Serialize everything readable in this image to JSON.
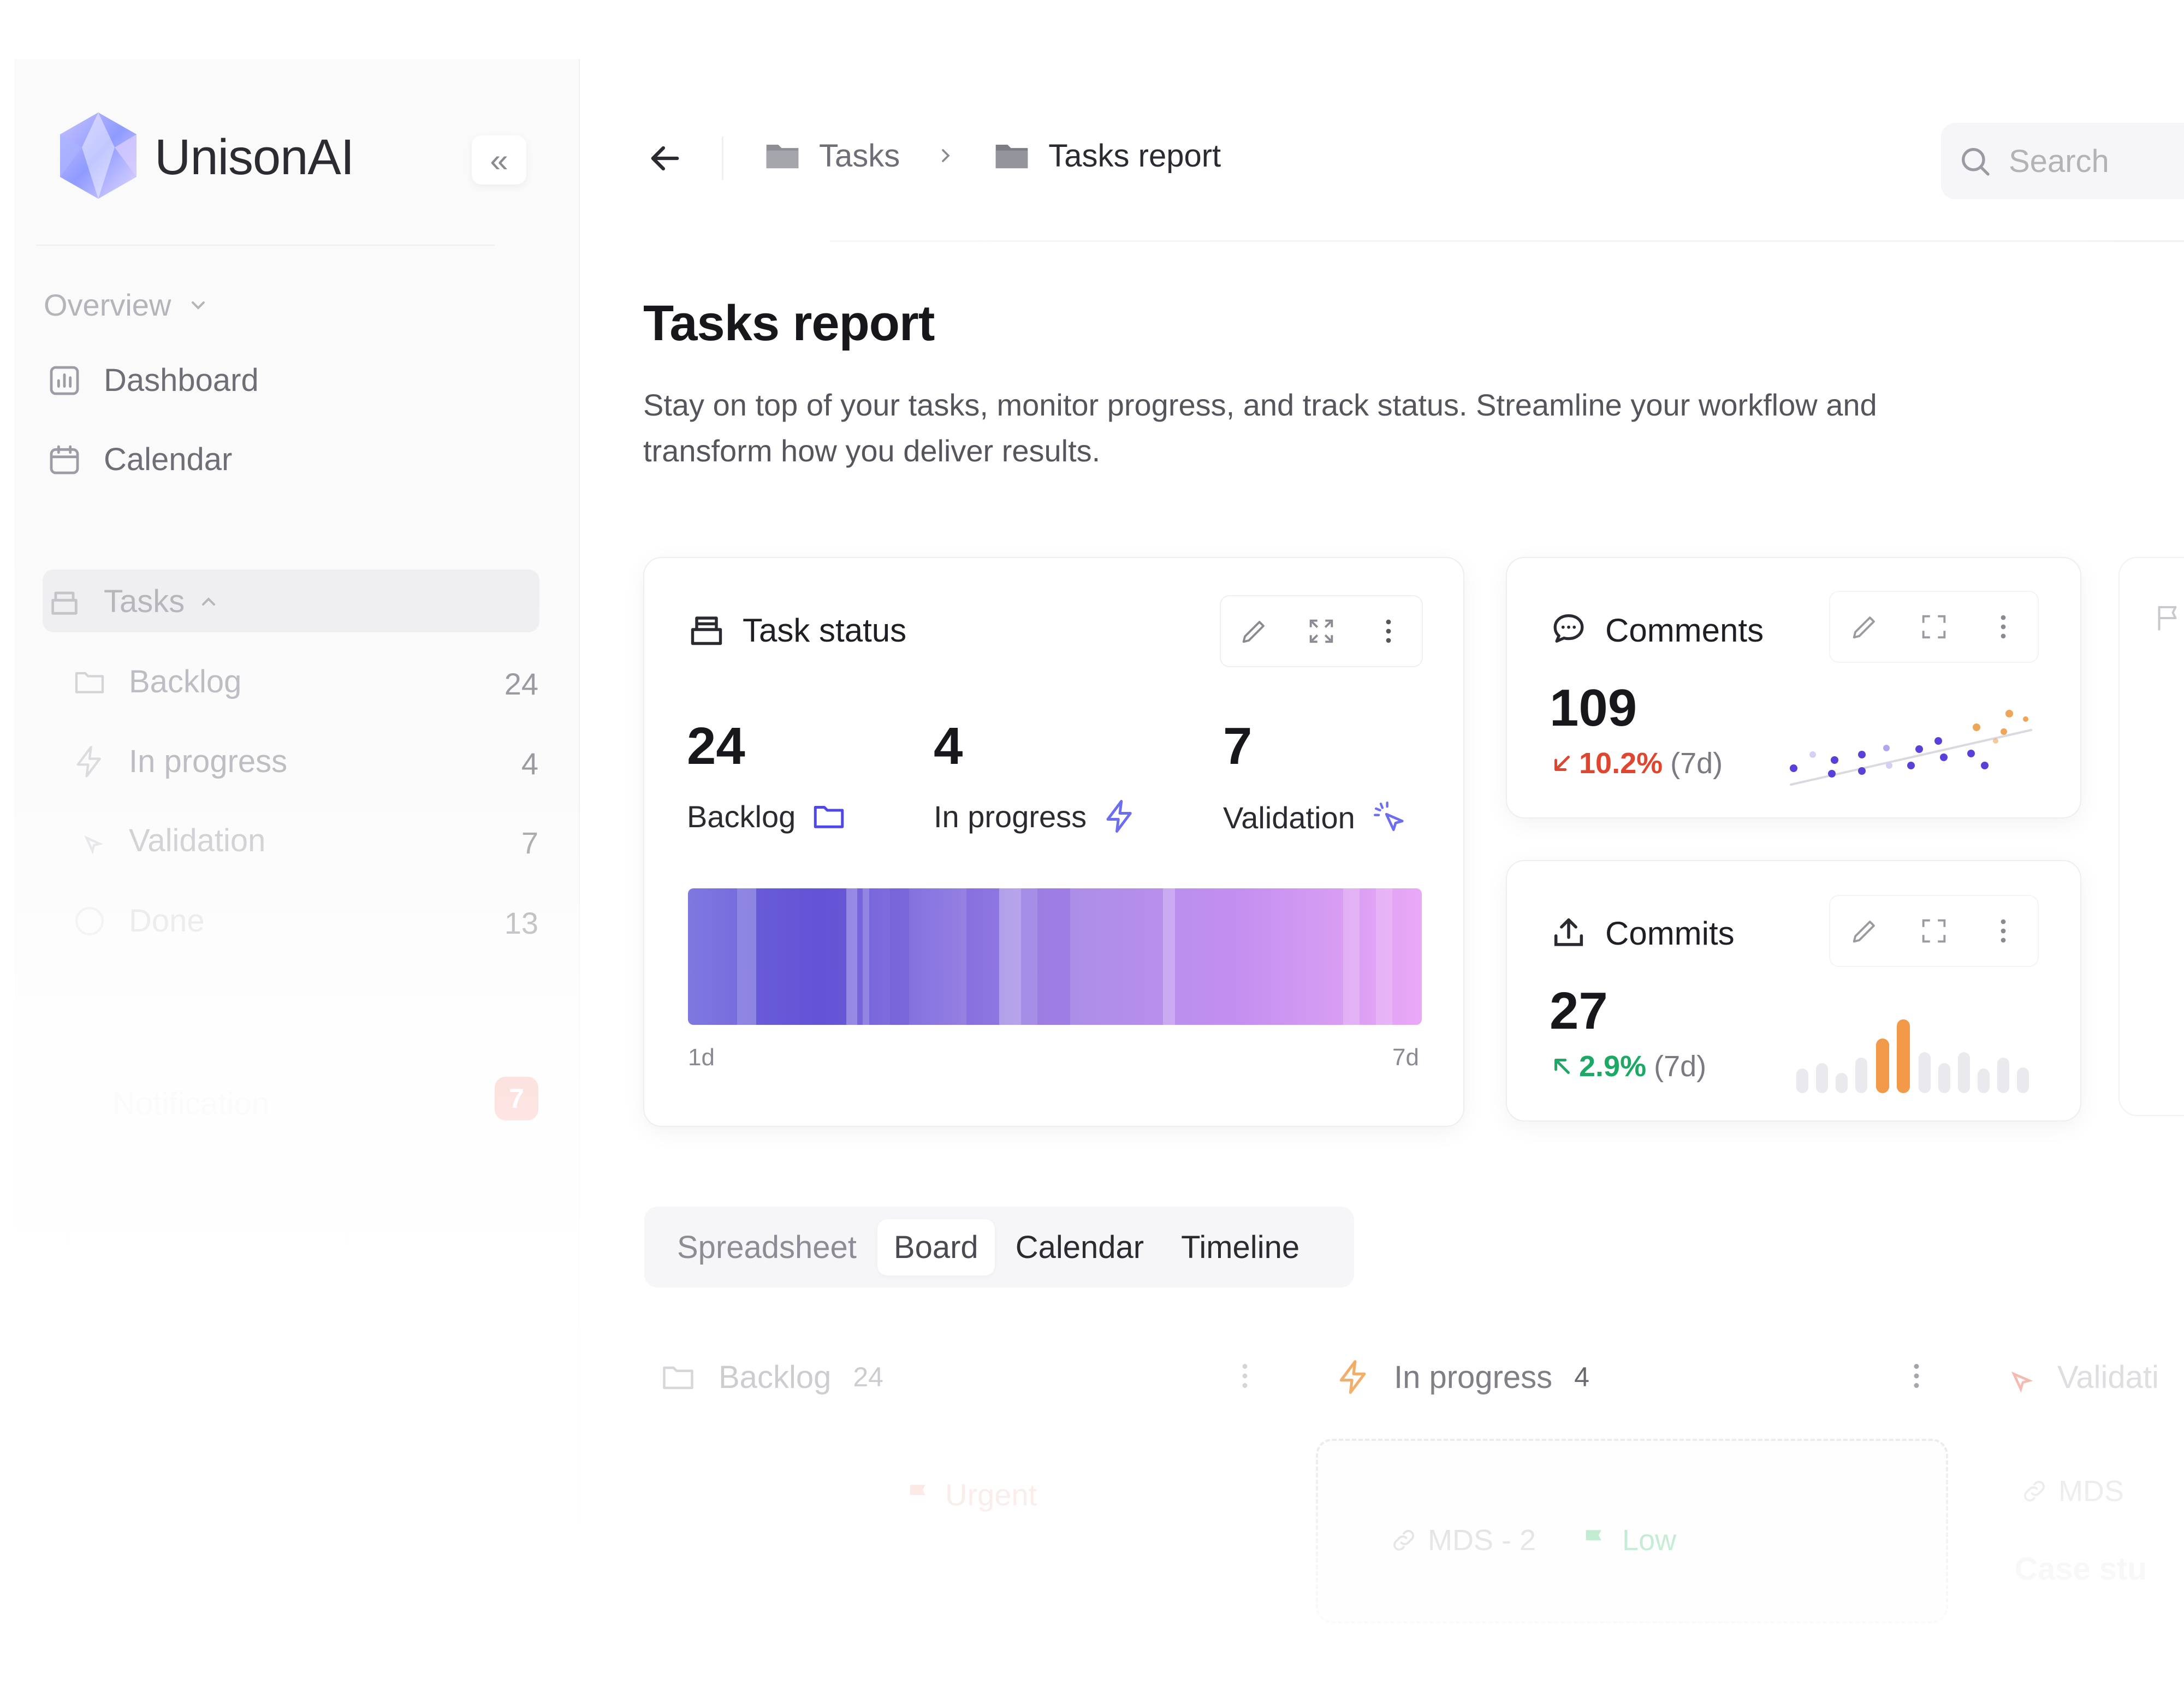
{
  "app": {
    "name": "UnisonAI",
    "collapse_label": "«"
  },
  "sidebar": {
    "section": "Overview",
    "items": [
      {
        "label": "Dashboard"
      },
      {
        "label": "Calendar"
      },
      {
        "label": "Tasks"
      }
    ],
    "subitems": [
      {
        "label": "Backlog",
        "count": "24"
      },
      {
        "label": "In progress",
        "count": "4"
      },
      {
        "label": "Validation",
        "count": "7"
      },
      {
        "label": "Done",
        "count": "13"
      }
    ],
    "notification": {
      "label": "Notification",
      "count": "7"
    }
  },
  "topbar": {
    "breadcrumb": [
      {
        "label": "Tasks"
      },
      {
        "label": "Tasks report"
      }
    ],
    "search_placeholder": "Search"
  },
  "page": {
    "title": "Tasks report",
    "description": "Stay on top of your tasks, monitor progress, and track status. Streamline your workflow and transform how you deliver results."
  },
  "task_status": {
    "title": "Task status",
    "metrics": [
      {
        "value": "24",
        "label": "Backlog",
        "icon": "folder-icon"
      },
      {
        "value": "4",
        "label": "In progress",
        "icon": "lightning-icon"
      },
      {
        "value": "7",
        "label": "Validation",
        "icon": "cursor-click-icon"
      }
    ],
    "axis_start": "1d",
    "axis_end": "7d",
    "colors": {
      "bar_start": "#7f78e0",
      "bar_end": "#e9a9f5"
    }
  },
  "comments": {
    "title": "Comments",
    "value": "109",
    "delta": "10.2%",
    "period": "(7d)",
    "trend": "down",
    "color": "#e0452f"
  },
  "commits": {
    "title": "Commits",
    "value": "27",
    "delta": "2.9%",
    "period": "(7d)",
    "trend": "up",
    "color": "#1ea866"
  },
  "tabs": [
    {
      "label": "Spreadsheet",
      "active": false
    },
    {
      "label": "Board",
      "active": true
    },
    {
      "label": "Calendar",
      "active": false
    },
    {
      "label": "Timeline",
      "active": false
    }
  ],
  "board": {
    "columns": [
      {
        "label": "Backlog",
        "count": "24"
      },
      {
        "label": "In progress",
        "count": "4"
      },
      {
        "label": "Validati"
      }
    ],
    "cards": [
      {
        "id": "MDS - 2",
        "priority": "Low"
      },
      {
        "id": "MDS"
      }
    ],
    "faded_priority": "Urgent",
    "faded_text": "Case stu"
  }
}
